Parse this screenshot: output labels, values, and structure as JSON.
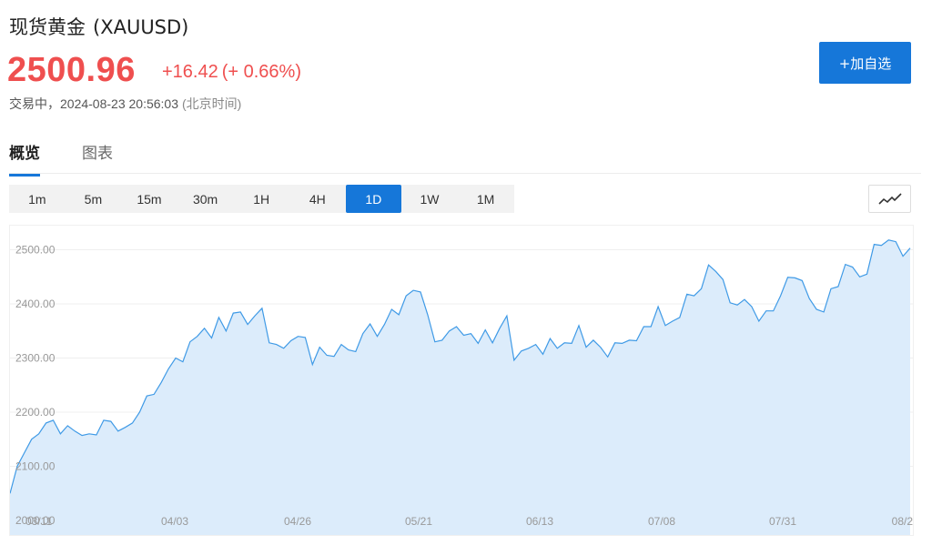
{
  "header": {
    "name": "现货黄金",
    "symbol": "(XAUUSD)",
    "price": "2500.96",
    "change": "+16.42",
    "change_pct": "(+ 0.66%)",
    "status": "交易中，2024-08-23 20:56:03",
    "timezone": "(北京时间)"
  },
  "add_button": {
    "label": "+加自选"
  },
  "tabs": [
    {
      "label": "概览",
      "active": true
    },
    {
      "label": "图表",
      "active": false
    }
  ],
  "periods": [
    {
      "label": "1m",
      "active": false
    },
    {
      "label": "5m",
      "active": false
    },
    {
      "label": "15m",
      "active": false
    },
    {
      "label": "30m",
      "active": false
    },
    {
      "label": "1H",
      "active": false
    },
    {
      "label": "4H",
      "active": false
    },
    {
      "label": "1D",
      "active": true
    },
    {
      "label": "1W",
      "active": false
    },
    {
      "label": "1M",
      "active": false
    }
  ],
  "chart_type_icon": "line-chart-icon",
  "colors": {
    "up": "#ef4f4f",
    "accent": "#1677d9",
    "line": "#3f9ae6",
    "area": "#dcecfb"
  },
  "chart_data": {
    "type": "area",
    "y_ticks": [
      "2500.00",
      "2400.00",
      "2300.00",
      "2200.00",
      "2100.00",
      "2000.00"
    ],
    "ylim": [
      2000,
      2550
    ],
    "x_ticks": [
      "03/11",
      "04/03",
      "04/26",
      "05/21",
      "06/13",
      "07/08",
      "07/31",
      "08/2"
    ],
    "grid": true,
    "values": [
      2050,
      2100,
      2125,
      2150,
      2160,
      2180,
      2185,
      2160,
      2175,
      2165,
      2157,
      2160,
      2158,
      2185,
      2183,
      2165,
      2172,
      2180,
      2200,
      2230,
      2233,
      2255,
      2280,
      2300,
      2293,
      2330,
      2340,
      2355,
      2337,
      2375,
      2350,
      2383,
      2385,
      2362,
      2378,
      2392,
      2328,
      2325,
      2318,
      2332,
      2340,
      2338,
      2288,
      2320,
      2305,
      2303,
      2325,
      2315,
      2312,
      2345,
      2363,
      2340,
      2362,
      2390,
      2380,
      2415,
      2425,
      2422,
      2380,
      2330,
      2333,
      2350,
      2358,
      2342,
      2345,
      2327,
      2352,
      2328,
      2355,
      2378,
      2296,
      2313,
      2318,
      2325,
      2307,
      2336,
      2318,
      2328,
      2327,
      2360,
      2320,
      2333,
      2320,
      2302,
      2328,
      2327,
      2333,
      2332,
      2358,
      2358,
      2395,
      2360,
      2368,
      2375,
      2418,
      2415,
      2428,
      2472,
      2460,
      2445,
      2402,
      2398,
      2408,
      2395,
      2368,
      2387,
      2387,
      2415,
      2449,
      2448,
      2443,
      2410,
      2390,
      2385,
      2428,
      2432,
      2473,
      2468,
      2450,
      2455,
      2510,
      2508,
      2518,
      2515,
      2488,
      2503
    ]
  }
}
